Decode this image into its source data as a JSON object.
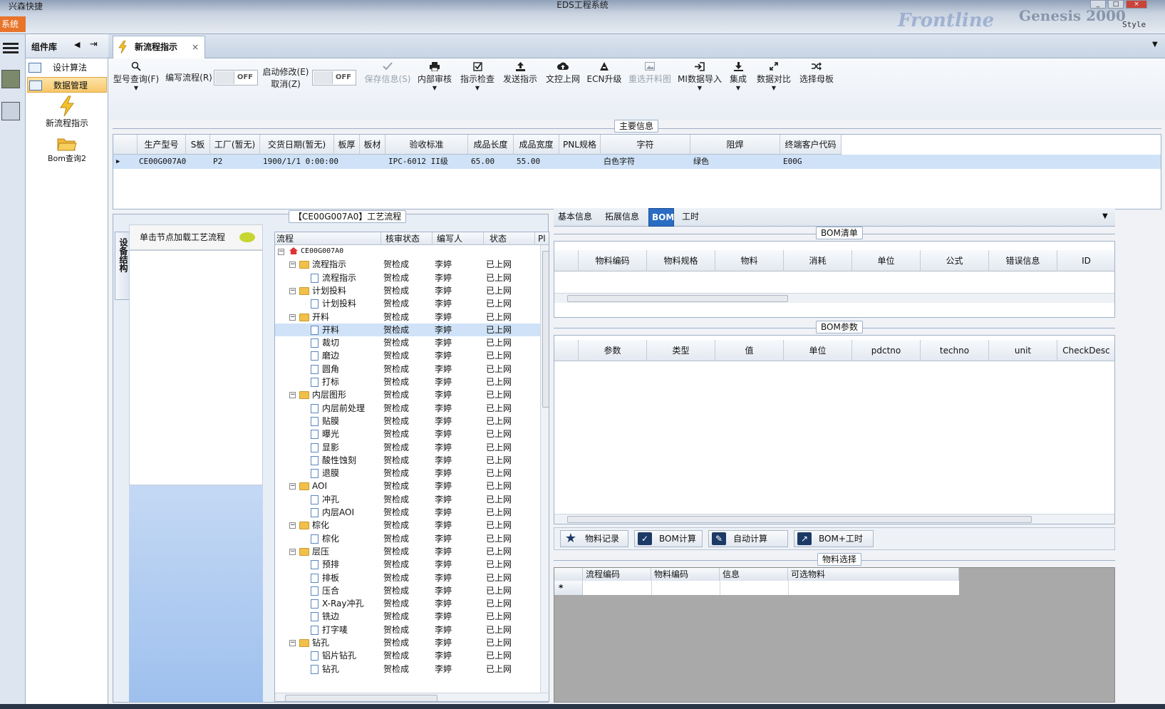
{
  "window": {
    "app_title": "兴森快捷",
    "title": "EDS工程系统",
    "banner_text": "Frontline",
    "banner_text2": "Genesis 2000",
    "style_label": "Style",
    "menu_tab": "系统"
  },
  "component_library": {
    "title": "组件库",
    "items": [
      {
        "label": "设计算法"
      },
      {
        "label": "数据管理"
      }
    ],
    "tiles": [
      {
        "label": "新流程指示"
      },
      {
        "label": "Bom查询2"
      }
    ]
  },
  "document_tab": {
    "label": "新流程指示"
  },
  "toolbar": {
    "items": [
      {
        "label": "型号查询(F)",
        "icon": "search-icon"
      },
      {
        "label": "编写流程(R)"
      },
      {
        "label": "启动修改(E)",
        "label2": "取消(Z)"
      },
      {
        "label": "保存信息(S)",
        "icon": "check-icon"
      },
      {
        "label": "内部审核",
        "icon": "print-icon"
      },
      {
        "label": "指示检查",
        "icon": "checkbox-icon"
      },
      {
        "label": "发送指示",
        "icon": "upload-icon"
      },
      {
        "label": "文控上网",
        "icon": "cloud-upload-icon"
      },
      {
        "label": "ECN升级",
        "icon": "ecn-icon"
      },
      {
        "label": "重选开料图",
        "icon": "image-icon"
      },
      {
        "label": "MI数据导入",
        "icon": "import-icon"
      },
      {
        "label": "集成",
        "icon": "download-icon"
      },
      {
        "label": "数据对比",
        "icon": "compare-icon"
      },
      {
        "label": "选择母板",
        "icon": "shuffle-icon"
      }
    ],
    "toggle_off": "OFF"
  },
  "main_info": {
    "title": "主要信息",
    "columns": [
      "生产型号",
      "S板",
      "工厂(暂无)",
      "交货日期(暂无)",
      "板厚",
      "板材",
      "验收标准",
      "成品长度",
      "成品宽度",
      "PNL规格",
      "字符",
      "阻焊",
      "终端客户代码"
    ],
    "row": [
      "CE00G007A0",
      "",
      "P2",
      "1900/1/1 0:00:00",
      "",
      "",
      "IPC-6012 II级",
      "65.00",
      "55.00",
      "",
      "白色字符",
      "绿色",
      "E00G"
    ]
  },
  "process_panel": {
    "title": "【CE00G007A0】工艺流程",
    "side_tab": "设备结构",
    "load_hint": "单击节点加载工艺流程"
  },
  "tree": {
    "columns": [
      "流程",
      "核审状态",
      "编写人",
      "状态",
      "Pl"
    ],
    "root": "CE00G007A0",
    "rows": [
      {
        "name": "流程指示",
        "level": 1,
        "folder": true,
        "s1": "贺检成",
        "s2": "李婷",
        "s3": "已上网"
      },
      {
        "name": "流程指示",
        "level": 2,
        "folder": false,
        "s1": "贺检成",
        "s2": "李婷",
        "s3": "已上网"
      },
      {
        "name": "计划投料",
        "level": 1,
        "folder": true,
        "s1": "贺检成",
        "s2": "李婷",
        "s3": "已上网"
      },
      {
        "name": "计划投料",
        "level": 2,
        "folder": false,
        "s1": "贺检成",
        "s2": "李婷",
        "s3": "已上网"
      },
      {
        "name": "开料",
        "level": 1,
        "folder": true,
        "s1": "贺检成",
        "s2": "李婷",
        "s3": "已上网"
      },
      {
        "name": "开料",
        "level": 2,
        "folder": false,
        "s1": "贺检成",
        "s2": "李婷",
        "s3": "已上网"
      },
      {
        "name": "裁切",
        "level": 2,
        "folder": false,
        "s1": "贺检成",
        "s2": "李婷",
        "s3": "已上网"
      },
      {
        "name": "磨边",
        "level": 2,
        "folder": false,
        "s1": "贺检成",
        "s2": "李婷",
        "s3": "已上网"
      },
      {
        "name": "圆角",
        "level": 2,
        "folder": false,
        "s1": "贺检成",
        "s2": "李婷",
        "s3": "已上网"
      },
      {
        "name": "打标",
        "level": 2,
        "folder": false,
        "s1": "贺检成",
        "s2": "李婷",
        "s3": "已上网"
      },
      {
        "name": "内层图形",
        "level": 1,
        "folder": true,
        "s1": "贺检成",
        "s2": "李婷",
        "s3": "已上网"
      },
      {
        "name": "内层前处理",
        "level": 2,
        "folder": false,
        "s1": "贺检成",
        "s2": "李婷",
        "s3": "已上网"
      },
      {
        "name": "贴膜",
        "level": 2,
        "folder": false,
        "s1": "贺检成",
        "s2": "李婷",
        "s3": "已上网"
      },
      {
        "name": "曝光",
        "level": 2,
        "folder": false,
        "s1": "贺检成",
        "s2": "李婷",
        "s3": "已上网"
      },
      {
        "name": "显影",
        "level": 2,
        "folder": false,
        "s1": "贺检成",
        "s2": "李婷",
        "s3": "已上网"
      },
      {
        "name": "酸性蚀刻",
        "level": 2,
        "folder": false,
        "s1": "贺检成",
        "s2": "李婷",
        "s3": "已上网"
      },
      {
        "name": "退膜",
        "level": 2,
        "folder": false,
        "s1": "贺检成",
        "s2": "李婷",
        "s3": "已上网"
      },
      {
        "name": "AOI",
        "level": 1,
        "folder": true,
        "s1": "贺检成",
        "s2": "李婷",
        "s3": "已上网"
      },
      {
        "name": "冲孔",
        "level": 2,
        "folder": false,
        "s1": "贺检成",
        "s2": "李婷",
        "s3": "已上网"
      },
      {
        "name": "内层AOI",
        "level": 2,
        "folder": false,
        "s1": "贺检成",
        "s2": "李婷",
        "s3": "已上网"
      },
      {
        "name": "棕化",
        "level": 1,
        "folder": true,
        "s1": "贺检成",
        "s2": "李婷",
        "s3": "已上网"
      },
      {
        "name": "棕化",
        "level": 2,
        "folder": false,
        "s1": "贺检成",
        "s2": "李婷",
        "s3": "已上网"
      },
      {
        "name": "层压",
        "level": 1,
        "folder": true,
        "s1": "贺检成",
        "s2": "李婷",
        "s3": "已上网"
      },
      {
        "name": "预排",
        "level": 2,
        "folder": false,
        "s1": "贺检成",
        "s2": "李婷",
        "s3": "已上网"
      },
      {
        "name": "排板",
        "level": 2,
        "folder": false,
        "s1": "贺检成",
        "s2": "李婷",
        "s3": "已上网"
      },
      {
        "name": "压合",
        "level": 2,
        "folder": false,
        "s1": "贺检成",
        "s2": "李婷",
        "s3": "已上网"
      },
      {
        "name": "X-Ray冲孔",
        "level": 2,
        "folder": false,
        "s1": "贺检成",
        "s2": "李婷",
        "s3": "已上网"
      },
      {
        "name": "铣边",
        "level": 2,
        "folder": false,
        "s1": "贺检成",
        "s2": "李婷",
        "s3": "已上网"
      },
      {
        "name": "打字唛",
        "level": 2,
        "folder": false,
        "s1": "贺检成",
        "s2": "李婷",
        "s3": "已上网"
      },
      {
        "name": "钻孔",
        "level": 1,
        "folder": true,
        "s1": "贺检成",
        "s2": "李婷",
        "s3": "已上网"
      },
      {
        "name": "铝片钻孔",
        "level": 2,
        "folder": false,
        "s1": "贺检成",
        "s2": "李婷",
        "s3": "已上网"
      },
      {
        "name": "钻孔",
        "level": 2,
        "folder": false,
        "s1": "贺检成",
        "s2": "李婷",
        "s3": "已上网"
      }
    ]
  },
  "right_tabs": [
    {
      "label": "基本信息"
    },
    {
      "label": "拓展信息"
    },
    {
      "label": "BOM"
    },
    {
      "label": "工时"
    }
  ],
  "bom_list": {
    "title": "BOM清单",
    "columns": [
      "物料编码",
      "物料规格",
      "物料",
      "消耗",
      "单位",
      "公式",
      "错误信息",
      "ID"
    ]
  },
  "bom_params": {
    "title": "BOM参数",
    "columns": [
      "参数",
      "类型",
      "值",
      "单位",
      "pdctno",
      "techno",
      "unit",
      "CheckDesc"
    ]
  },
  "actions": [
    {
      "label": "物料记录",
      "icon": "star-icon"
    },
    {
      "label": "BOM计算",
      "icon": "check-icon"
    },
    {
      "label": "自动计算",
      "icon": "edit-icon"
    },
    {
      "label": "BOM+工时",
      "icon": "external-link-icon"
    }
  ],
  "material_select": {
    "title": "物料选择",
    "columns": [
      "流程编码",
      "物料编码",
      "信息",
      "可选物料"
    ],
    "new_row_marker": "*"
  },
  "colors": {
    "accent": "#2b6cc4",
    "menu": "#e8742a",
    "selection": "#cfe2f7"
  }
}
